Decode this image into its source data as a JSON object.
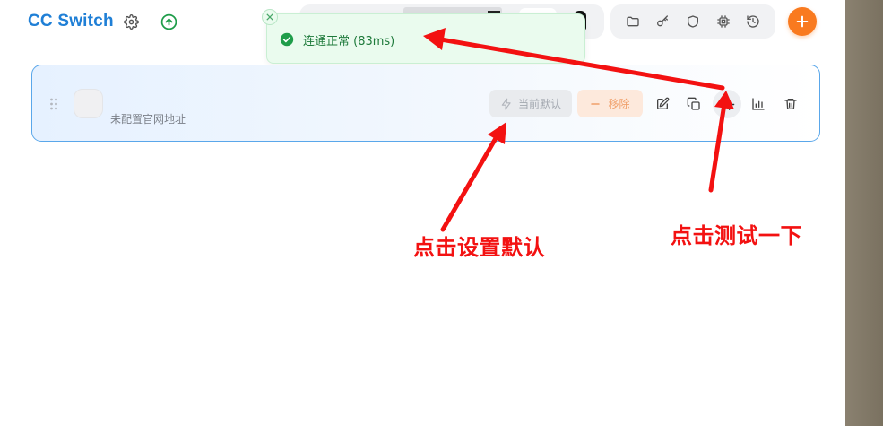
{
  "header": {
    "app_title": "CC Switch",
    "icons": [
      "settings-icon",
      "update-icon"
    ],
    "toolbar_icons": [
      "folder-icon",
      "key-icon",
      "shield-icon",
      "chip-icon",
      "history-icon"
    ],
    "add_icon": "plus-icon"
  },
  "toast": {
    "message": "连通正常 (83ms)",
    "status_color": "#1f9d4a"
  },
  "provider_card": {
    "url_text": "未配置官网地址",
    "default_label": "当前默认",
    "remove_label": "移除",
    "accent": "#5aa7ea",
    "action_icons": [
      "edit-icon",
      "copy-icon",
      "test-icon",
      "usage-chart-icon",
      "delete-icon"
    ]
  },
  "annotations": {
    "set_default": "点击设置默认",
    "test_it": "点击测试一下",
    "color": "#f31111"
  }
}
